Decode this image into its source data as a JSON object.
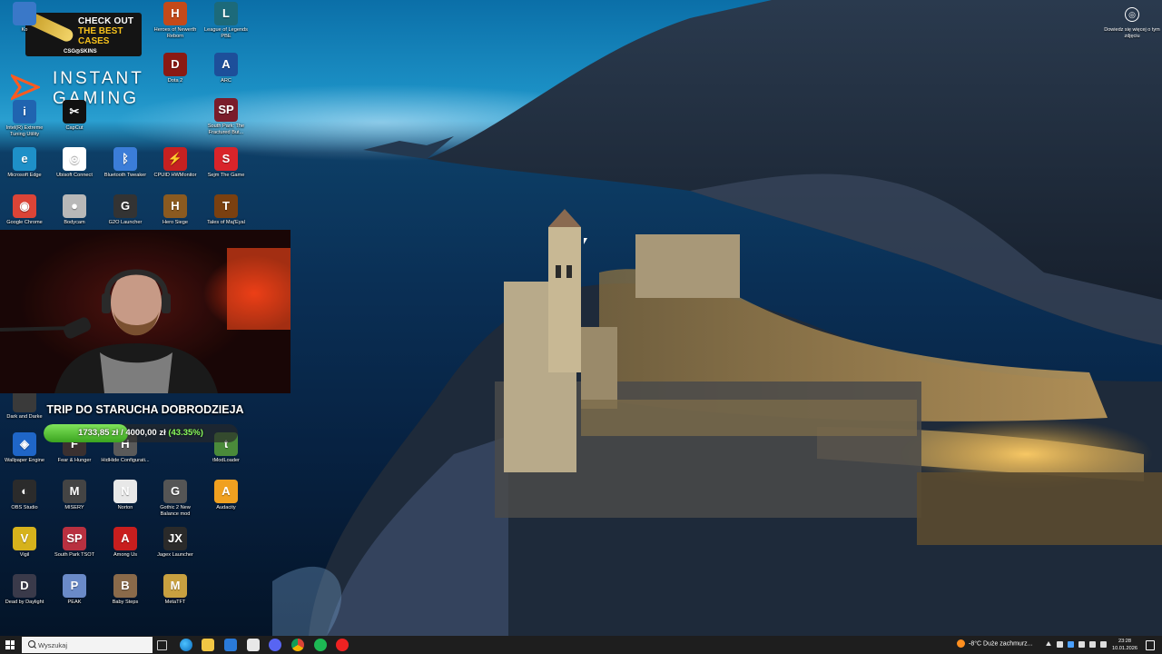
{
  "desktop_icons": [
    {
      "label": "Ko",
      "glyph": "",
      "color": "#3a78c8"
    },
    {
      "label": "Heroes of Newerth Reborn",
      "glyph": "H",
      "color": "#c44a1a"
    },
    {
      "label": "League of Legends PBE",
      "glyph": "L",
      "color": "#1c6a7a"
    },
    {
      "label": "Dota 2",
      "glyph": "D",
      "color": "#8a1a14"
    },
    {
      "label": "ARC",
      "glyph": "A",
      "color": "#1d4f9a"
    },
    {
      "label": "South Park: The Fractured But...",
      "glyph": "SP",
      "color": "#7a1c2a"
    },
    {
      "label": "Intel(R) Extreme Tuning Utility",
      "glyph": "i",
      "color": "#2064b0"
    },
    {
      "label": "CapCut",
      "glyph": "✂",
      "color": "#111111"
    },
    {
      "label": "Microsoft Edge",
      "glyph": "e",
      "color": "#1e90c8"
    },
    {
      "label": "Ubisoft Connect",
      "glyph": "◎",
      "color": "#ffffff"
    },
    {
      "label": "Bluetooth Tweaker",
      "glyph": "ᛒ",
      "color": "#3b7dd8"
    },
    {
      "label": "CPUID HWMonitor",
      "glyph": "⚡",
      "color": "#c62121"
    },
    {
      "label": "Sejm The Game",
      "glyph": "S",
      "color": "#d9242a"
    },
    {
      "label": "Google Chrome",
      "glyph": "◉",
      "color": "#db4437"
    },
    {
      "label": "Bodycam",
      "glyph": "●",
      "color": "#b8b8b8"
    },
    {
      "label": "G2O Launcher",
      "glyph": "G",
      "color": "#333333"
    },
    {
      "label": "Hero Siege",
      "glyph": "H",
      "color": "#8a5a20"
    },
    {
      "label": "Tales of Maj'Eyal",
      "glyph": "T",
      "color": "#7a4010"
    },
    {
      "label": "Dark and Darke",
      "glyph": "",
      "color": "#3a3a3a"
    },
    {
      "label": "Wallpaper Engine",
      "glyph": "◈",
      "color": "#1f66c8"
    },
    {
      "label": "Fear & Hunger",
      "glyph": "F",
      "color": "#3a3030"
    },
    {
      "label": "HidHide Configurati...",
      "glyph": "H",
      "color": "#5a5a5a"
    },
    {
      "label": "tModLoader",
      "glyph": "t",
      "color": "#4a8a3a"
    },
    {
      "label": "OBS Studio",
      "glyph": "◐",
      "color": "#2b2b2b"
    },
    {
      "label": "MISERY",
      "glyph": "M",
      "color": "#444444"
    },
    {
      "label": "Norton",
      "glyph": "N",
      "color": "#e8e8e8"
    },
    {
      "label": "Gothic 2 New Balance mod",
      "glyph": "G",
      "color": "#555555"
    },
    {
      "label": "Audacity",
      "glyph": "A",
      "color": "#f0a020"
    },
    {
      "label": "Vigil",
      "glyph": "V",
      "color": "#d6b21c"
    },
    {
      "label": "South Park TSOT",
      "glyph": "SP",
      "color": "#b83040"
    },
    {
      "label": "Among Us",
      "glyph": "A",
      "color": "#c81e1e"
    },
    {
      "label": "Jagex Launcher",
      "glyph": "JX",
      "color": "#2a2a2a"
    },
    {
      "label": "Dead by Daylight",
      "glyph": "D",
      "color": "#3a3a4a"
    },
    {
      "label": "PEAK",
      "glyph": "P",
      "color": "#6a8ac8"
    },
    {
      "label": "Baby Steps",
      "glyph": "B",
      "color": "#8a6a4a"
    },
    {
      "label": "MetaTFT",
      "glyph": "M",
      "color": "#c8a040"
    }
  ],
  "promo": {
    "line1": "CHECK OUT",
    "line2": "THE BEST",
    "line3": "CASES",
    "brand": "CSG◎SKINS"
  },
  "brand": {
    "line1": "INSTANT",
    "line2": "GAMING"
  },
  "donation": {
    "title": "TRIP DO STARUCHA DOBRODZIEJA",
    "amount": "1733,85 zł / 4000,00 zł",
    "percent_label": "(43.35%)",
    "percent": 43.35
  },
  "info_corner": {
    "text": "Dowiedz się więcej o tym zdjęciu"
  },
  "taskbar": {
    "search_placeholder": "Wyszukaj",
    "weather": "-8°C  Duże zachmurz...",
    "time": "23:28",
    "date": "10.01.2026"
  }
}
